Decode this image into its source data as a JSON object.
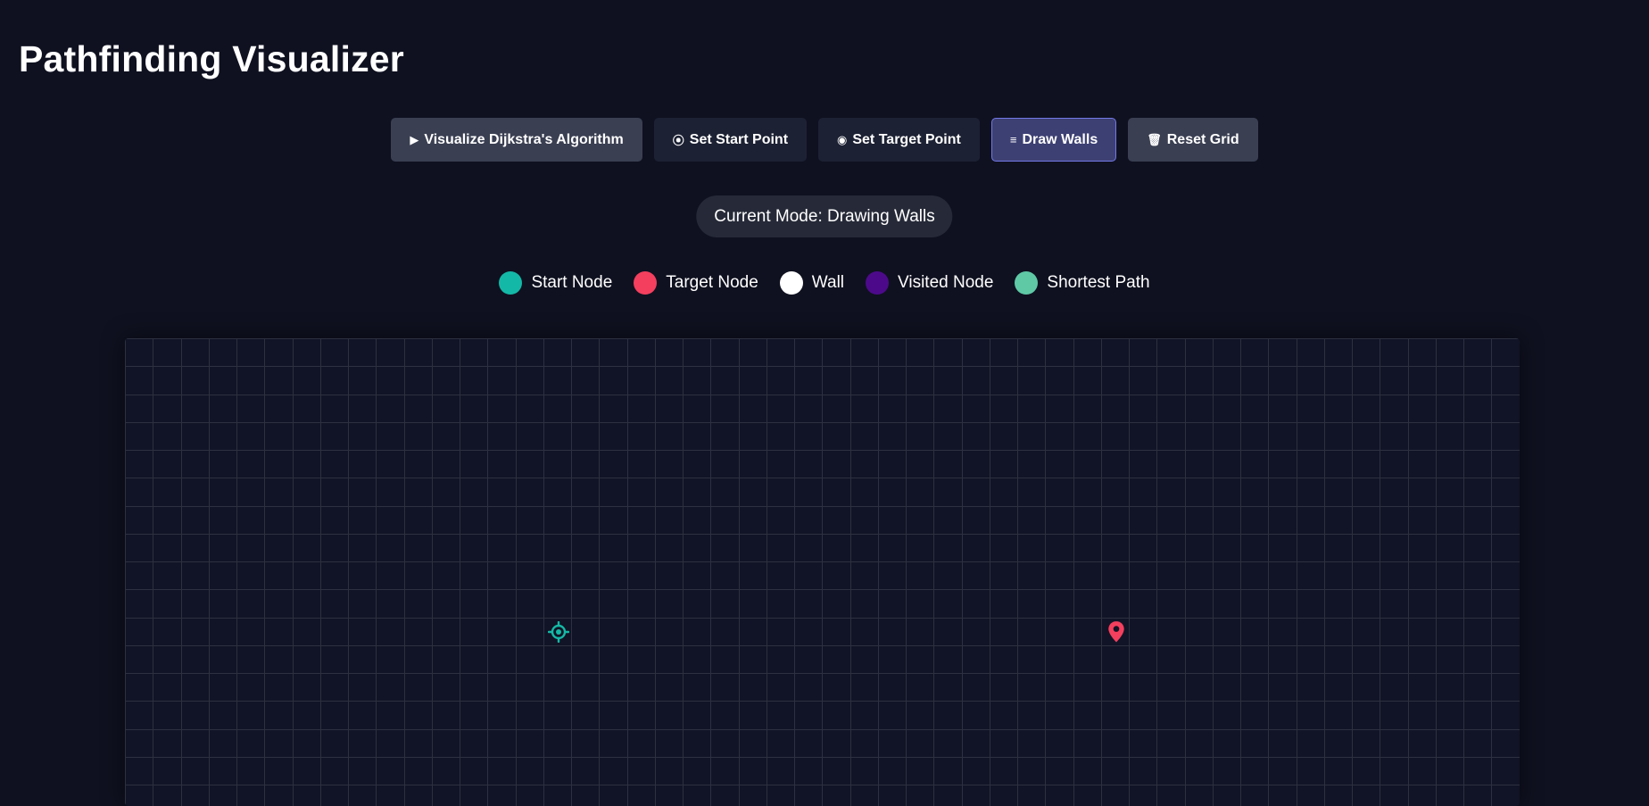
{
  "app": {
    "title": "Pathfinding Visualizer"
  },
  "toolbar": {
    "buttons": [
      {
        "id": "visualize",
        "icon": "play-icon",
        "glyph": "▶",
        "label": "Visualize Dijkstra's Algorithm"
      },
      {
        "id": "set-start",
        "icon": "start-point-icon",
        "glyph": "⦿",
        "label": "Set Start Point"
      },
      {
        "id": "set-target",
        "icon": "target-point-icon",
        "glyph": "◉",
        "label": "Set Target Point"
      },
      {
        "id": "draw-walls",
        "icon": "walls-icon",
        "glyph": "≡",
        "label": "Draw Walls",
        "active": true
      },
      {
        "id": "reset-grid",
        "icon": "trash-icon",
        "glyph": "🗑",
        "label": "Reset Grid"
      }
    ]
  },
  "mode": {
    "text": "Current Mode: Drawing Walls"
  },
  "legend": [
    {
      "label": "Start Node",
      "color": "#14b8a6"
    },
    {
      "label": "Target Node",
      "color": "#f43f5e"
    },
    {
      "label": "Wall",
      "color": "#ffffff"
    },
    {
      "label": "Visited Node",
      "color": "#4c0a8a"
    },
    {
      "label": "Shortest Path",
      "color": "#5fc9a6"
    }
  ],
  "grid": {
    "columns": 50,
    "visible_rows": 17,
    "start": {
      "row": 10,
      "col": 15,
      "icon": "start-crosshair-icon",
      "color": "#14b8a6"
    },
    "target": {
      "row": 10,
      "col": 35,
      "icon": "target-pin-icon",
      "color": "#f43f5e"
    }
  }
}
